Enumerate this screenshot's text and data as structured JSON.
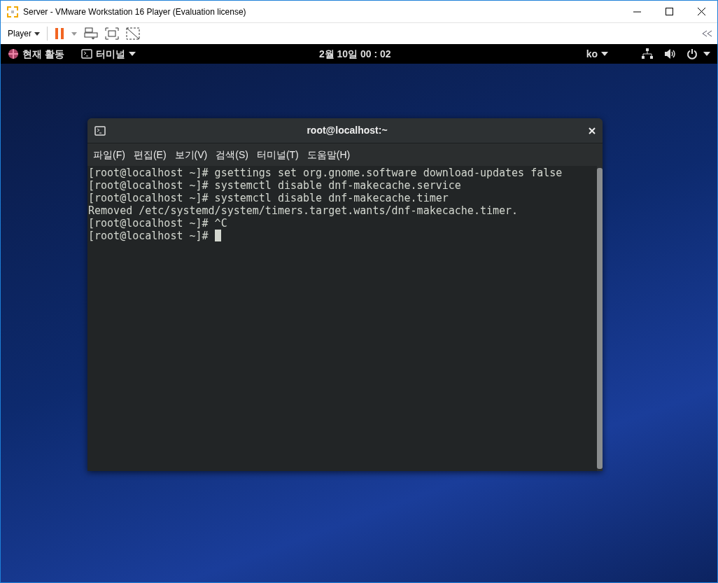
{
  "window": {
    "title": "Server - VMware Workstation 16 Player (Evaluation license)"
  },
  "toolbar": {
    "player_menu": "Player"
  },
  "top_bar": {
    "activities": "현재 활동",
    "app_menu": "터미널",
    "clock": "2월 10일 00 : 02",
    "input_method": "ko"
  },
  "terminal": {
    "title": "root@localhost:~",
    "menu": [
      "파일(F)",
      "편집(E)",
      "보기(V)",
      "검색(S)",
      "터미널(T)",
      "도움말(H)"
    ],
    "lines": [
      "[root@localhost ~]# gsettings set org.gnome.software download-updates false",
      "[root@localhost ~]# systemctl disable dnf-makecache.service",
      "[root@localhost ~]# systemctl disable dnf-makecache.timer",
      "Removed /etc/systemd/system/timers.target.wants/dnf-makecache.timer.",
      "[root@localhost ~]# ^C",
      "[root@localhost ~]# "
    ],
    "cursor": true
  }
}
